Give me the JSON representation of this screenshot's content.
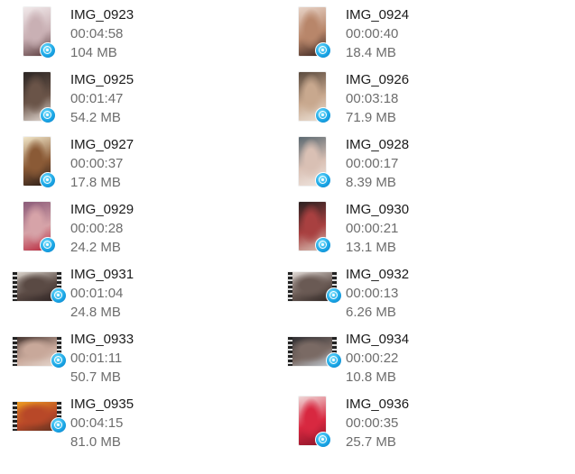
{
  "files": [
    {
      "name": "IMG_0923",
      "duration": "00:04:58",
      "size": "104 MB",
      "thumbnail": {
        "orientation": "portrait",
        "colors": [
          "#f1e9ea",
          "#c9b0b4",
          "#5a3c3e"
        ]
      }
    },
    {
      "name": "IMG_0924",
      "duration": "00:00:40",
      "size": "18.4 MB",
      "thumbnail": {
        "orientation": "portrait",
        "colors": [
          "#e8d4c8",
          "#b8866a",
          "#3a2520"
        ]
      }
    },
    {
      "name": "IMG_0925",
      "duration": "00:01:47",
      "size": "54.2 MB",
      "thumbnail": {
        "orientation": "portrait",
        "colors": [
          "#2b2523",
          "#6a5448",
          "#e6ded8"
        ]
      }
    },
    {
      "name": "IMG_0926",
      "duration": "00:03:18",
      "size": "71.9 MB",
      "thumbnail": {
        "orientation": "portrait",
        "colors": [
          "#5a4a3e",
          "#c8a88e",
          "#ece2d8"
        ]
      }
    },
    {
      "name": "IMG_0927",
      "duration": "00:00:37",
      "size": "17.8 MB",
      "thumbnail": {
        "orientation": "portrait",
        "colors": [
          "#f2e7c9",
          "#8a5a36",
          "#2a1d18"
        ]
      }
    },
    {
      "name": "IMG_0928",
      "duration": "00:00:17",
      "size": "8.39 MB",
      "thumbnail": {
        "orientation": "portrait",
        "colors": [
          "#5a6870",
          "#d9c0b4",
          "#f0e6e0"
        ]
      }
    },
    {
      "name": "IMG_0929",
      "duration": "00:00:28",
      "size": "24.2 MB",
      "thumbnail": {
        "orientation": "portrait",
        "colors": [
          "#8a5a78",
          "#d6a3a8",
          "#b8243a"
        ]
      }
    },
    {
      "name": "IMG_0930",
      "duration": "00:00:21",
      "size": "13.1 MB",
      "thumbnail": {
        "orientation": "portrait",
        "colors": [
          "#2a2020",
          "#a84040",
          "#d9c4b8"
        ]
      }
    },
    {
      "name": "IMG_0931",
      "duration": "00:01:04",
      "size": "24.8 MB",
      "thumbnail": {
        "orientation": "landscape",
        "colors": [
          "#e4ded6",
          "#5a4a44",
          "#2a2020"
        ]
      }
    },
    {
      "name": "IMG_0932",
      "duration": "00:00:13",
      "size": "6.26 MB",
      "thumbnail": {
        "orientation": "landscape",
        "colors": [
          "#e8e2de",
          "#6a5a54",
          "#2a2220"
        ]
      }
    },
    {
      "name": "IMG_0933",
      "duration": "00:01:11",
      "size": "50.7 MB",
      "thumbnail": {
        "orientation": "landscape",
        "colors": [
          "#3a2a26",
          "#c8a89a",
          "#e8dcd4"
        ]
      }
    },
    {
      "name": "IMG_0934",
      "duration": "00:00:22",
      "size": "10.8 MB",
      "thumbnail": {
        "orientation": "landscape",
        "colors": [
          "#2a2a2e",
          "#7a6a64",
          "#c8d4de"
        ]
      }
    },
    {
      "name": "IMG_0935",
      "duration": "00:04:15",
      "size": "81.0 MB",
      "thumbnail": {
        "orientation": "landscape",
        "colors": [
          "#f0a020",
          "#b84828",
          "#5a3020"
        ]
      }
    },
    {
      "name": "IMG_0936",
      "duration": "00:00:35",
      "size": "25.7 MB",
      "thumbnail": {
        "orientation": "portrait",
        "colors": [
          "#f0d8d8",
          "#d82840",
          "#8a1428"
        ]
      }
    }
  ],
  "icons": {
    "file_type_badge": "video-player-icon"
  },
  "colors": {
    "background": "#ffffff",
    "name_text": "#1a1a1a",
    "detail_text": "#6d6d6d",
    "badge_blue": "#1aa7e6"
  }
}
